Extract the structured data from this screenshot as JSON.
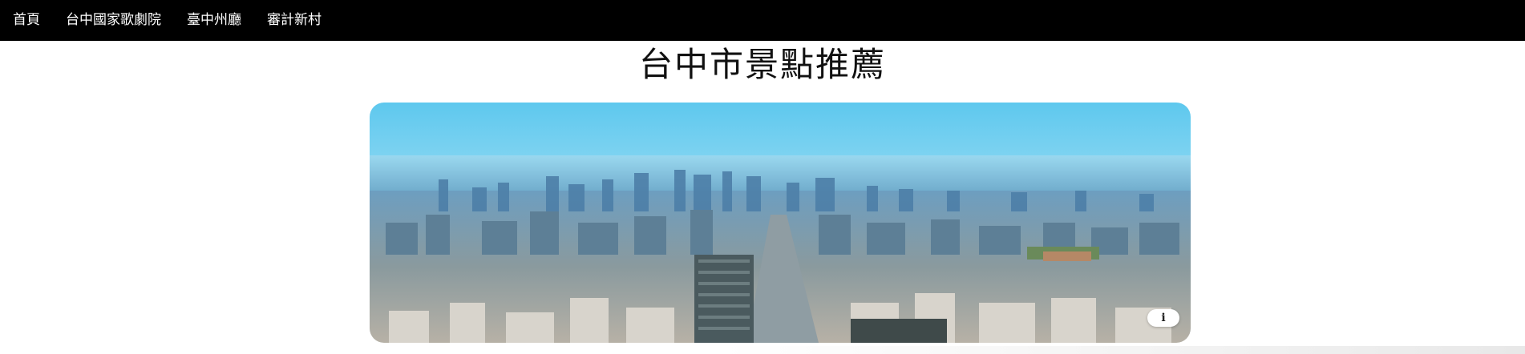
{
  "nav": {
    "items": [
      {
        "label": "首頁"
      },
      {
        "label": "台中國家歌劇院"
      },
      {
        "label": "臺中州廳"
      },
      {
        "label": "審計新村"
      }
    ]
  },
  "page": {
    "title": "台中市景點推薦"
  },
  "hero": {
    "info_icon": "info-icon",
    "info_glyph": "i"
  },
  "colors": {
    "nav_bg": "#000000",
    "nav_text": "#ffffff",
    "title_text": "#111111",
    "sky_top": "#5ec8ee",
    "sky_bottom": "#e8f7fb"
  }
}
